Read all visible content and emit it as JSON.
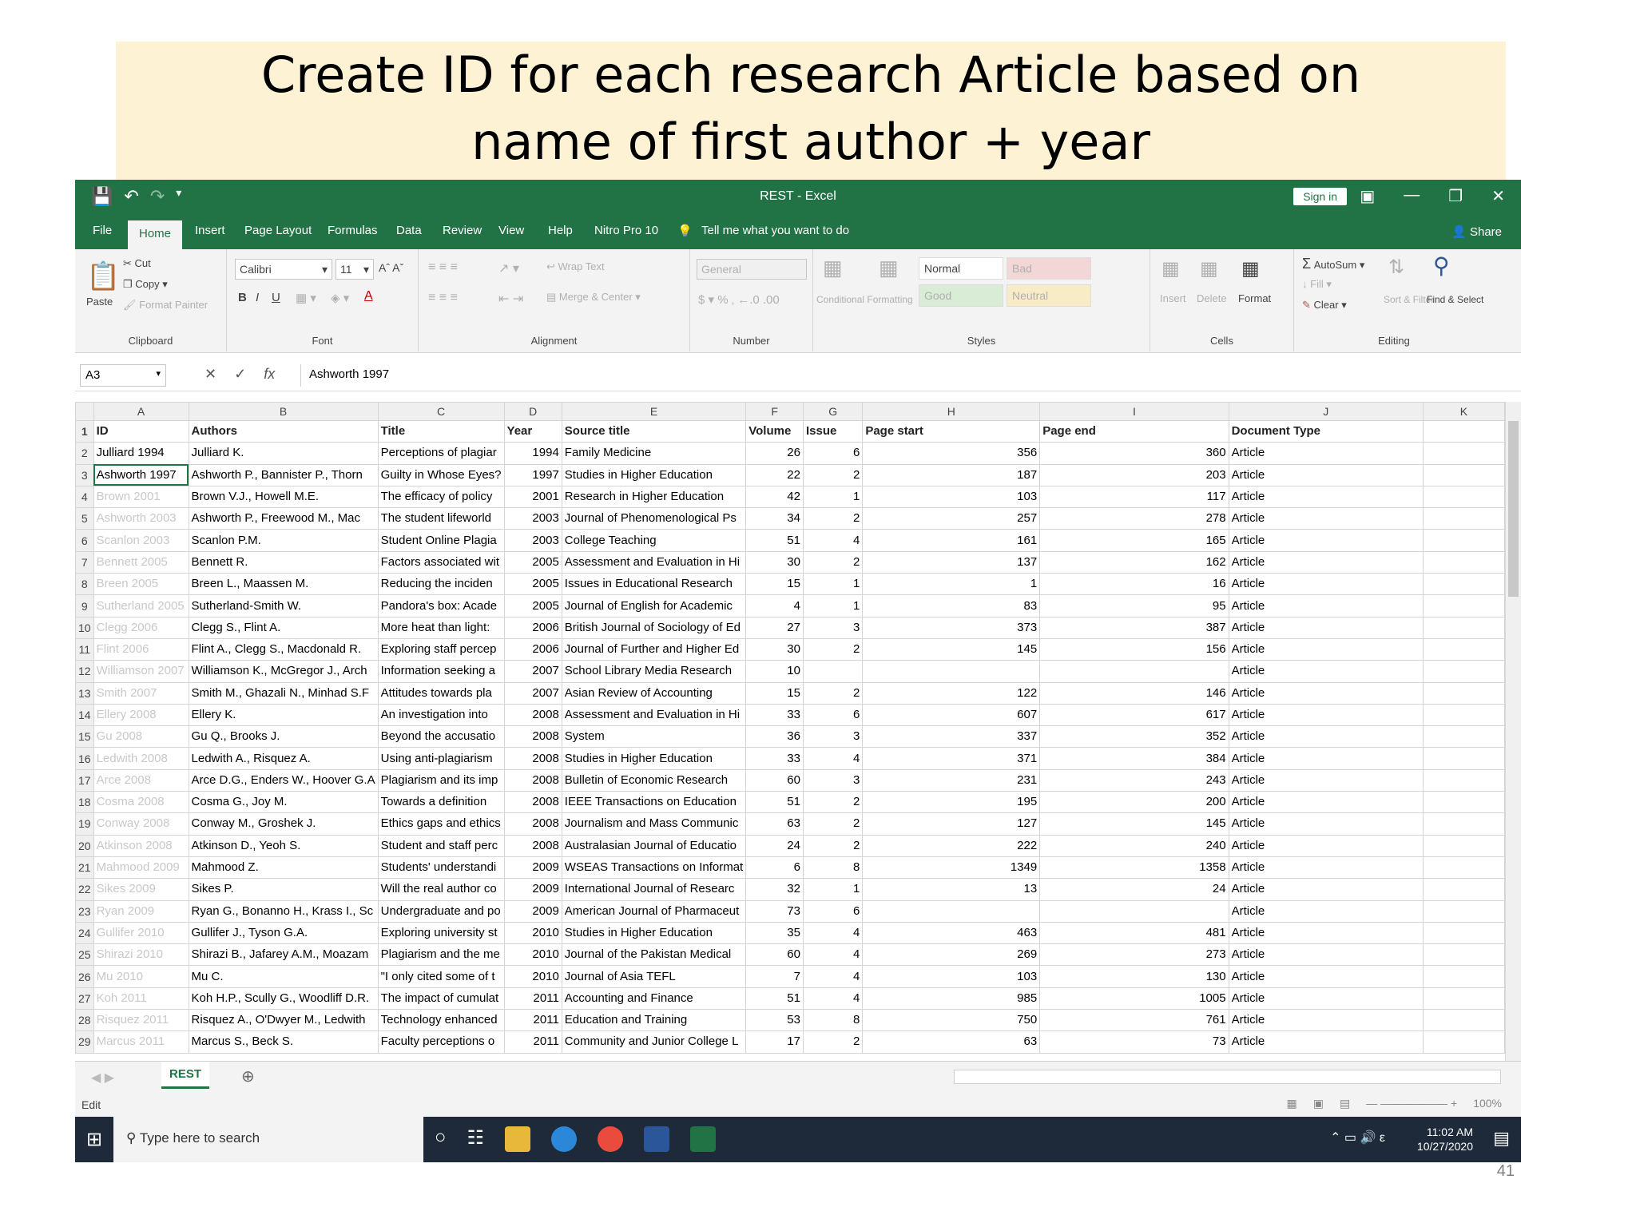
{
  "slide": {
    "title_line1": "Create ID for each research Article based on",
    "title_line2": "name of first author + year",
    "page_number": "41"
  },
  "window": {
    "title": "REST  -  Excel",
    "sign_in": "Sign in",
    "share": "Share"
  },
  "ribbon_tabs": [
    "File",
    "Home",
    "Insert",
    "Page Layout",
    "Formulas",
    "Data",
    "Review",
    "View",
    "Help",
    "Nitro Pro 10",
    "Tell me what you want to do"
  ],
  "ribbon": {
    "clipboard": {
      "paste": "Paste",
      "cut": "Cut",
      "copy": "Copy",
      "format_painter": "Format Painter",
      "label": "Clipboard"
    },
    "font": {
      "name": "Calibri",
      "size": "11",
      "label": "Font"
    },
    "alignment": {
      "wrap": "Wrap Text",
      "merge": "Merge & Center",
      "label": "Alignment"
    },
    "number": {
      "format": "General",
      "label": "Number"
    },
    "styles": {
      "conditional": "Conditional Formatting",
      "format_as": "Format as Table",
      "normal": "Normal",
      "bad": "Bad",
      "good": "Good",
      "neutral": "Neutral",
      "label": "Styles"
    },
    "cells": {
      "insert": "Insert",
      "delete": "Delete",
      "format": "Format",
      "label": "Cells"
    },
    "editing": {
      "autosum": "AutoSum",
      "fill": "Fill",
      "clear": "Clear",
      "sort": "Sort & Filter",
      "find": "Find & Select",
      "label": "Editing"
    }
  },
  "formula_bar": {
    "name_box": "A3",
    "content": "Ashworth 1997"
  },
  "columns": [
    "A",
    "B",
    "C",
    "D",
    "E",
    "F",
    "G",
    "H",
    "I",
    "J",
    "K"
  ],
  "header_row": [
    "ID",
    "Authors",
    "Title",
    "Year",
    "Source title",
    "Volume",
    "Issue",
    "Page start",
    "Page end",
    "Document Type"
  ],
  "rows": [
    [
      "Julliard 1994",
      "Julliard K.",
      "Perceptions of plagiar",
      "1994",
      "Family Medicine",
      "26",
      "6",
      "356",
      "360",
      "Article"
    ],
    [
      "Ashworth 1997",
      "Ashworth P., Bannister P., Thorn",
      "Guilty in Whose Eyes?",
      "1997",
      "Studies in Higher Education",
      "22",
      "2",
      "187",
      "203",
      "Article"
    ],
    [
      "Brown 2001",
      "Brown V.J., Howell M.E.",
      "The efficacy of policy",
      "2001",
      "Research in Higher Education",
      "42",
      "1",
      "103",
      "117",
      "Article"
    ],
    [
      "Ashworth 2003",
      "Ashworth P., Freewood M., Mac",
      "The student lifeworld",
      "2003",
      "Journal of Phenomenological Ps",
      "34",
      "2",
      "257",
      "278",
      "Article"
    ],
    [
      "Scanlon 2003",
      "Scanlon P.M.",
      "Student Online Plagia",
      "2003",
      "College Teaching",
      "51",
      "4",
      "161",
      "165",
      "Article"
    ],
    [
      "Bennett 2005",
      "Bennett R.",
      "Factors associated wit",
      "2005",
      "Assessment and Evaluation in Hi",
      "30",
      "2",
      "137",
      "162",
      "Article"
    ],
    [
      "Breen 2005",
      "Breen L., Maassen M.",
      "Reducing the inciden",
      "2005",
      "Issues in Educational Research",
      "15",
      "1",
      "1",
      "16",
      "Article"
    ],
    [
      "Sutherland 2005",
      "Sutherland-Smith W.",
      "Pandora's box: Acade",
      "2005",
      "Journal of English for Academic",
      "4",
      "1",
      "83",
      "95",
      "Article"
    ],
    [
      "Clegg 2006",
      "Clegg S., Flint A.",
      "More heat than light:",
      "2006",
      "British Journal of Sociology of Ed",
      "27",
      "3",
      "373",
      "387",
      "Article"
    ],
    [
      "Flint 2006",
      "Flint A., Clegg S., Macdonald R.",
      "Exploring staff percep",
      "2006",
      "Journal of Further and Higher Ed",
      "30",
      "2",
      "145",
      "156",
      "Article"
    ],
    [
      "Williamson 2007",
      "Williamson K., McGregor J., Arch",
      "Information seeking a",
      "2007",
      "School Library Media Research",
      "10",
      "",
      "",
      "",
      "Article"
    ],
    [
      "Smith 2007",
      "Smith M., Ghazali N., Minhad S.F",
      "Attitudes towards pla",
      "2007",
      "Asian Review of Accounting",
      "15",
      "2",
      "122",
      "146",
      "Article"
    ],
    [
      "Ellery 2008",
      "Ellery K.",
      "An investigation into",
      "2008",
      "Assessment and Evaluation in Hi",
      "33",
      "6",
      "607",
      "617",
      "Article"
    ],
    [
      "Gu 2008",
      "Gu Q., Brooks J.",
      "Beyond the accusatio",
      "2008",
      "System",
      "36",
      "3",
      "337",
      "352",
      "Article"
    ],
    [
      "Ledwith 2008",
      "Ledwith A., Risquez A.",
      "Using anti-plagiarism",
      "2008",
      "Studies in Higher Education",
      "33",
      "4",
      "371",
      "384",
      "Article"
    ],
    [
      "Arce 2008",
      "Arce D.G., Enders W., Hoover G.A",
      "Plagiarism and its imp",
      "2008",
      "Bulletin of Economic Research",
      "60",
      "3",
      "231",
      "243",
      "Article"
    ],
    [
      "Cosma 2008",
      "Cosma G., Joy M.",
      "Towards a definition",
      "2008",
      "IEEE Transactions on Education",
      "51",
      "2",
      "195",
      "200",
      "Article"
    ],
    [
      "Conway 2008",
      "Conway M., Groshek J.",
      "Ethics gaps and ethics",
      "2008",
      "Journalism and Mass Communic",
      "63",
      "2",
      "127",
      "145",
      "Article"
    ],
    [
      "Atkinson 2008",
      "Atkinson D., Yeoh S.",
      "Student and staff perc",
      "2008",
      "Australasian Journal of Educatio",
      "24",
      "2",
      "222",
      "240",
      "Article"
    ],
    [
      "Mahmood 2009",
      "Mahmood Z.",
      "Students' understandi",
      "2009",
      "WSEAS Transactions on Informat",
      "6",
      "8",
      "1349",
      "1358",
      "Article"
    ],
    [
      "Sikes 2009",
      "Sikes P.",
      "Will the real author co",
      "2009",
      "International Journal of Researc",
      "32",
      "1",
      "13",
      "24",
      "Article"
    ],
    [
      "Ryan 2009",
      "Ryan G., Bonanno H., Krass I., Sc",
      "Undergraduate and po",
      "2009",
      "American Journal of Pharmaceut",
      "73",
      "6",
      "",
      "",
      "Article"
    ],
    [
      "Gullifer 2010",
      "Gullifer J., Tyson G.A.",
      "Exploring university st",
      "2010",
      "Studies in Higher Education",
      "35",
      "4",
      "463",
      "481",
      "Article"
    ],
    [
      "Shirazi 2010",
      "Shirazi B., Jafarey A.M., Moazam",
      "Plagiarism and the me",
      "2010",
      "Journal of the Pakistan Medical",
      "60",
      "4",
      "269",
      "273",
      "Article"
    ],
    [
      "Mu 2010",
      "Mu C.",
      "\"I only cited some of t",
      "2010",
      "Journal of Asia TEFL",
      "7",
      "4",
      "103",
      "130",
      "Article"
    ],
    [
      "Koh 2011",
      "Koh H.P., Scully G., Woodliff D.R.",
      "The impact of cumulat",
      "2011",
      "Accounting and Finance",
      "51",
      "4",
      "985",
      "1005",
      "Article"
    ],
    [
      "Risquez 2011",
      "Risquez A., O'Dwyer M., Ledwith",
      "Technology enhanced",
      "2011",
      "Education and Training",
      "53",
      "8",
      "750",
      "761",
      "Article"
    ],
    [
      "Marcus 2011",
      "Marcus S., Beck S.",
      "Faculty perceptions o",
      "2011",
      "Community and Junior College L",
      "17",
      "2",
      "63",
      "73",
      "Article"
    ]
  ],
  "sheet_tab": "REST",
  "status": {
    "mode": "Edit",
    "zoom": "100%"
  },
  "taskbar": {
    "search_placeholder": "Type here to search",
    "time": "11:02 AM",
    "date": "10/27/2020"
  },
  "colors": {
    "excel_green": "#217346",
    "title_bg": "#fdf2d4",
    "taskbar": "#1e2a3a"
  }
}
